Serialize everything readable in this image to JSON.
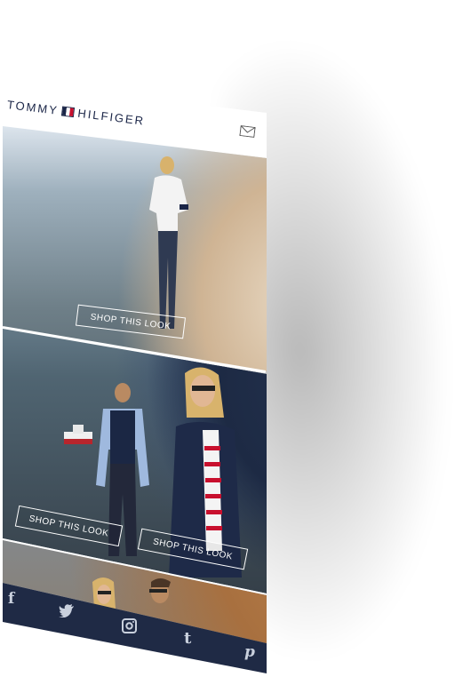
{
  "header": {
    "brand_left": "TOMMY",
    "brand_right": "HILFIGER",
    "flag_colors": [
      "#1a2547",
      "#ffffff",
      "#c8102e"
    ]
  },
  "icons": {
    "mail": "mail-icon"
  },
  "hero": [
    {
      "button_label": "SHOP THIS LOOK"
    },
    {
      "buttons": [
        "SHOP THIS LOOK",
        "SHOP THIS LOOK"
      ]
    }
  ],
  "social": {
    "facebook": "f",
    "twitter": "twitter-icon",
    "instagram": "instagram-icon",
    "tumblr": "t",
    "pinterest": "p"
  },
  "colors": {
    "navy": "#1f2a45",
    "accent_red": "#c8102e"
  }
}
